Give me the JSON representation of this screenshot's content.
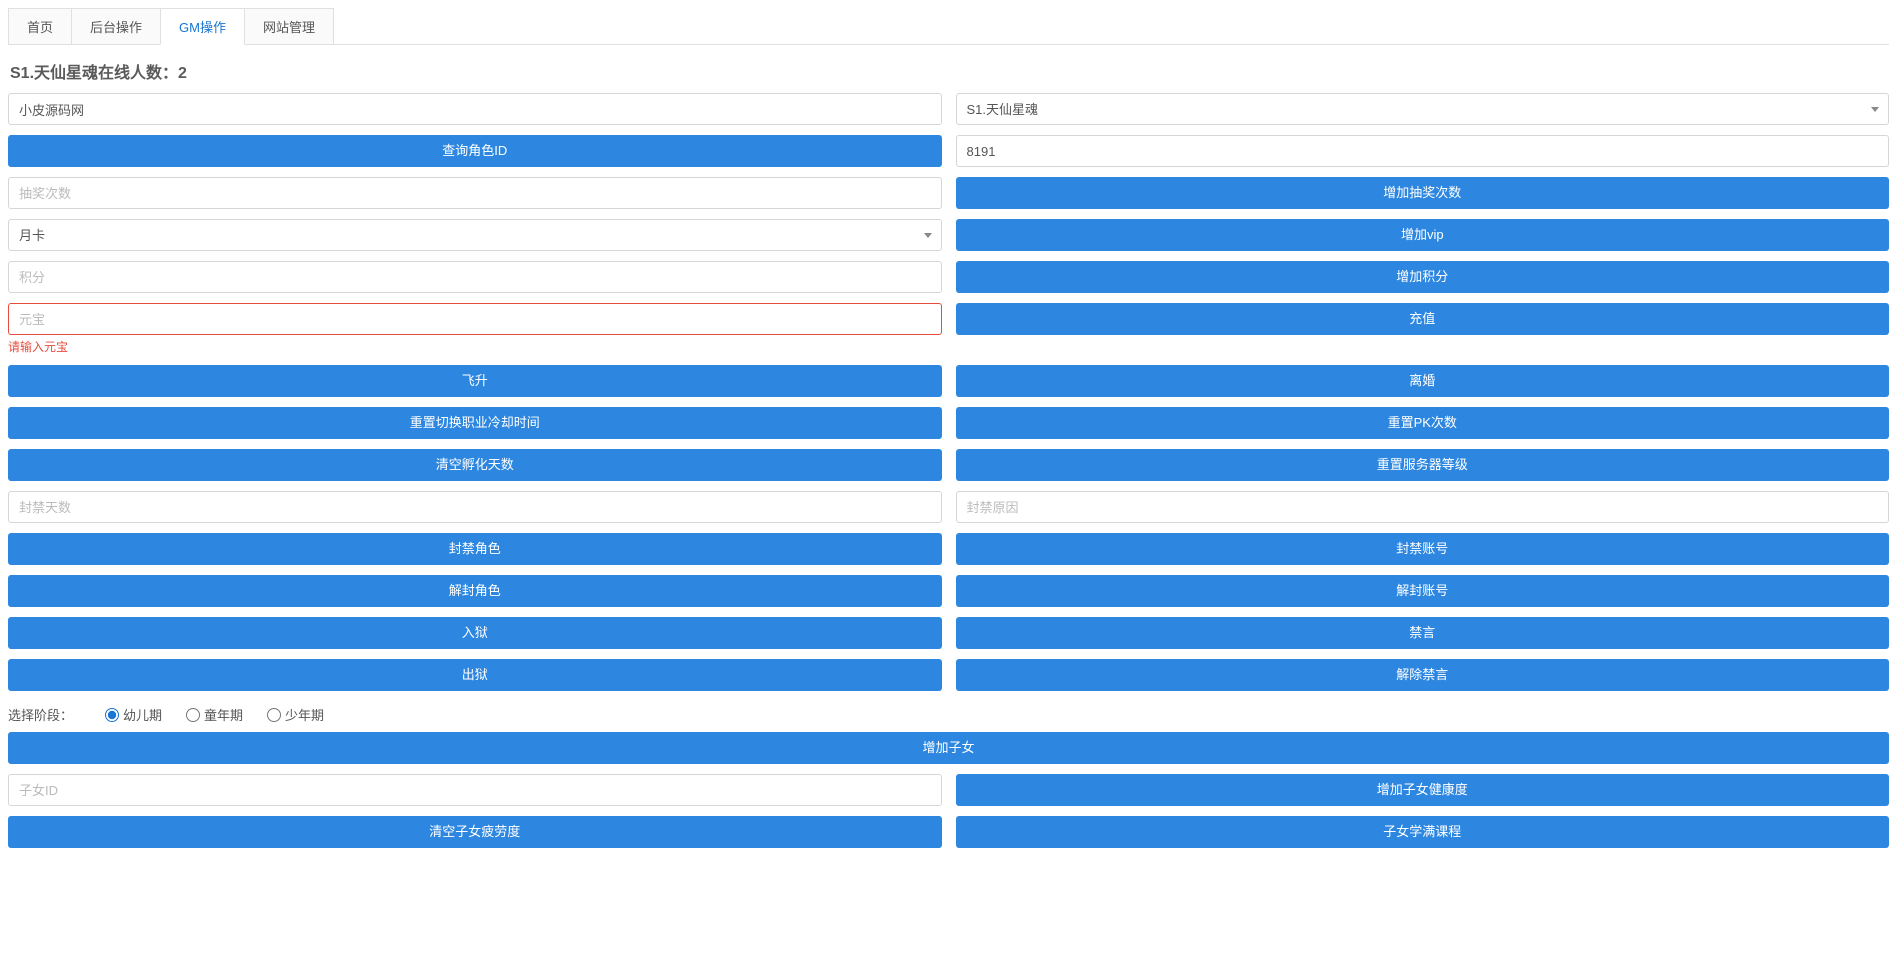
{
  "tabs": [
    "首页",
    "后台操作",
    "GM操作",
    "网站管理"
  ],
  "active_tab_index": 2,
  "heading": "S1.天仙星魂在线人数：2",
  "player_name_value": "小皮源码网",
  "server_selected": "S1.天仙星魂",
  "btn_query_role_id": "查询角色ID",
  "role_id_value": "8191",
  "draw_count_placeholder": "抽奖次数",
  "btn_add_draw": "增加抽奖次数",
  "vip_selected": "月卡",
  "btn_add_vip": "增加vip",
  "points_placeholder": "积分",
  "btn_add_points": "增加积分",
  "yuanbao_placeholder": "元宝",
  "yuanbao_error": "请输入元宝",
  "btn_recharge": "充值",
  "btn_ascend": "飞升",
  "btn_divorce": "离婚",
  "btn_reset_job_cd": "重置切换职业冷却时间",
  "btn_reset_pk": "重置PK次数",
  "btn_clear_incubation": "清空孵化天数",
  "btn_reset_server_level": "重置服务器等级",
  "ban_days_placeholder": "封禁天数",
  "ban_reason_placeholder": "封禁原因",
  "btn_ban_role": "封禁角色",
  "btn_ban_account": "封禁账号",
  "btn_unban_role": "解封角色",
  "btn_unban_account": "解封账号",
  "btn_jail": "入狱",
  "btn_mute": "禁言",
  "btn_release": "出狱",
  "btn_unmute": "解除禁言",
  "stage_label": "选择阶段：",
  "stage_options": [
    "幼儿期",
    "童年期",
    "少年期"
  ],
  "stage_selected_index": 0,
  "btn_add_child": "增加子女",
  "child_id_placeholder": "子女ID",
  "btn_add_child_health": "增加子女健康度",
  "btn_clear_child_fatigue": "清空子女疲劳度",
  "btn_child_full_course": "子女学满课程"
}
